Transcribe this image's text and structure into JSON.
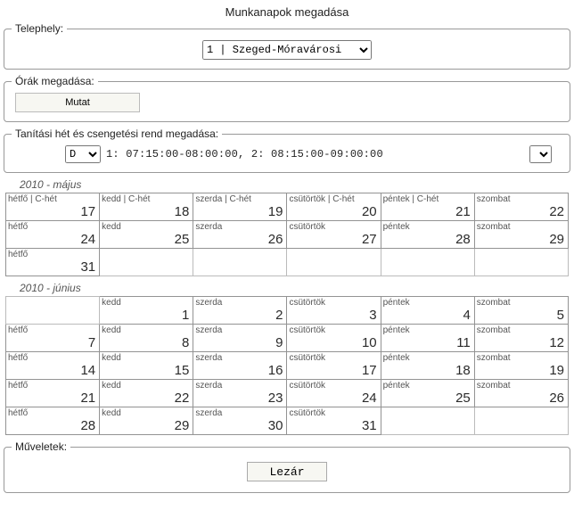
{
  "page_title": "Munkanapok megadása",
  "site": {
    "legend": "Telephely:",
    "selected": "1 | Szeged-Móravárosi"
  },
  "hours": {
    "legend": "Órák megadása:",
    "button": "Mutat"
  },
  "schedule": {
    "legend": "Tanítási hét és csengetési rend megadása:",
    "selector": "D",
    "times": "1: 07:15:00-08:00:00, 2: 08:15:00-09:00:00"
  },
  "months": [
    {
      "title": "2010 - május",
      "weeks": [
        [
          {
            "label": "hétfő | C-hét",
            "num": "17",
            "cls": "pink"
          },
          {
            "label": "kedd | C-hét",
            "num": "18",
            "cls": "pink"
          },
          {
            "label": "szerda | C-hét",
            "num": "19",
            "cls": "pink"
          },
          {
            "label": "csütörtök | C-hét",
            "num": "20",
            "cls": "pink"
          },
          {
            "label": "péntek | C-hét",
            "num": "21",
            "cls": "pink"
          },
          {
            "label": "szombat",
            "num": "22",
            "cls": "gold"
          }
        ],
        [
          {
            "label": "hétfő",
            "num": "24",
            "cls": "green"
          },
          {
            "label": "kedd",
            "num": "25",
            "cls": "green"
          },
          {
            "label": "szerda",
            "num": "26",
            "cls": "green"
          },
          {
            "label": "csütörtök",
            "num": "27",
            "cls": "green"
          },
          {
            "label": "péntek",
            "num": "28",
            "cls": "green"
          },
          {
            "label": "szombat",
            "num": "29",
            "cls": "gold"
          }
        ],
        [
          {
            "label": "hétfő",
            "num": "31",
            "cls": "green"
          },
          {
            "blank": true
          },
          {
            "blank": true
          },
          {
            "blank": true
          },
          {
            "blank": true
          },
          {
            "blank": true
          }
        ]
      ]
    },
    {
      "title": "2010 - június",
      "weeks": [
        [
          {
            "blank": true
          },
          {
            "label": "kedd",
            "num": "1",
            "cls": "green"
          },
          {
            "label": "szerda",
            "num": "2",
            "cls": "green"
          },
          {
            "label": "csütörtök",
            "num": "3",
            "cls": "green"
          },
          {
            "label": "péntek",
            "num": "4",
            "cls": "green"
          },
          {
            "label": "szombat",
            "num": "5",
            "cls": "gold"
          }
        ],
        [
          {
            "label": "hétfő",
            "num": "7",
            "cls": "green"
          },
          {
            "label": "kedd",
            "num": "8",
            "cls": "green"
          },
          {
            "label": "szerda",
            "num": "9",
            "cls": "green"
          },
          {
            "label": "csütörtök",
            "num": "10",
            "cls": "green"
          },
          {
            "label": "péntek",
            "num": "11",
            "cls": "green"
          },
          {
            "label": "szombat",
            "num": "12",
            "cls": "gold"
          }
        ],
        [
          {
            "label": "hétfő",
            "num": "14",
            "cls": "green"
          },
          {
            "label": "kedd",
            "num": "15",
            "cls": "green"
          },
          {
            "label": "szerda",
            "num": "16",
            "cls": "green"
          },
          {
            "label": "csütörtök",
            "num": "17",
            "cls": "green"
          },
          {
            "label": "péntek",
            "num": "18",
            "cls": "green"
          },
          {
            "label": "szombat",
            "num": "19",
            "cls": "gold"
          }
        ],
        [
          {
            "label": "hétfő",
            "num": "21",
            "cls": "green"
          },
          {
            "label": "kedd",
            "num": "22",
            "cls": "green"
          },
          {
            "label": "szerda",
            "num": "23",
            "cls": "green"
          },
          {
            "label": "csütörtök",
            "num": "24",
            "cls": "green"
          },
          {
            "label": "péntek",
            "num": "25",
            "cls": "green"
          },
          {
            "label": "szombat",
            "num": "26",
            "cls": "gold"
          }
        ],
        [
          {
            "label": "hétfő",
            "num": "28",
            "cls": "green"
          },
          {
            "label": "kedd",
            "num": "29",
            "cls": "green"
          },
          {
            "label": "szerda",
            "num": "30",
            "cls": "green"
          },
          {
            "label": "csütörtök",
            "num": "31",
            "cls": "green"
          },
          {
            "blank": true
          },
          {
            "blank": true
          }
        ]
      ]
    }
  ],
  "actions": {
    "legend": "Műveletek:",
    "close": "Lezár"
  }
}
